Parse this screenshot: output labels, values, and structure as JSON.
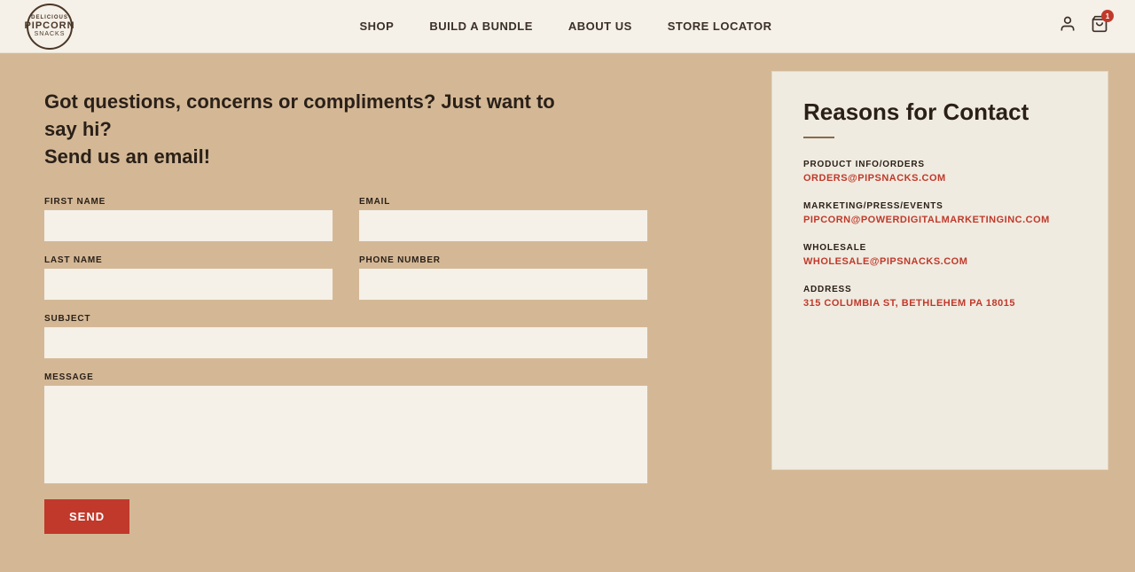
{
  "header": {
    "logo": {
      "top_text": "Delicious",
      "main_text": "PIPCORN",
      "bottom_text": "Snacks"
    },
    "nav": [
      {
        "id": "shop",
        "label": "SHOP"
      },
      {
        "id": "build-bundle",
        "label": "BUILD A BUNDLE"
      },
      {
        "id": "about-us",
        "label": "ABOUT US"
      },
      {
        "id": "store-locator",
        "label": "STORE LOCATOR"
      }
    ],
    "cart_count": "1"
  },
  "main": {
    "headline_line1": "Got questions, concerns or compliments? Just want to say hi?",
    "headline_line2": "Send us an email!",
    "form": {
      "first_name_label": "FIRST NAME",
      "last_name_label": "LAST NAME",
      "email_label": "EMAIL",
      "phone_label": "PHONE NUMBER",
      "subject_label": "SUBJECT",
      "message_label": "MESSAGE",
      "send_button": "SEND"
    },
    "reasons_panel": {
      "title": "Reasons for Contact",
      "items": [
        {
          "category": "PRODUCT INFO/ORDERS",
          "email": "ORDERS@PIPSNACKS.COM"
        },
        {
          "category": "MARKETING/PRESS/EVENTS",
          "email": "PIPCORN@POWERDIGITALMARKETINGINC.COM"
        },
        {
          "category": "WHOLESALE",
          "email": "WHOLESALE@PIPSNACKS.COM"
        },
        {
          "category": "ADDRESS",
          "email": "315 COLUMBIA ST, BETHLEHEM PA 18015"
        }
      ]
    }
  }
}
